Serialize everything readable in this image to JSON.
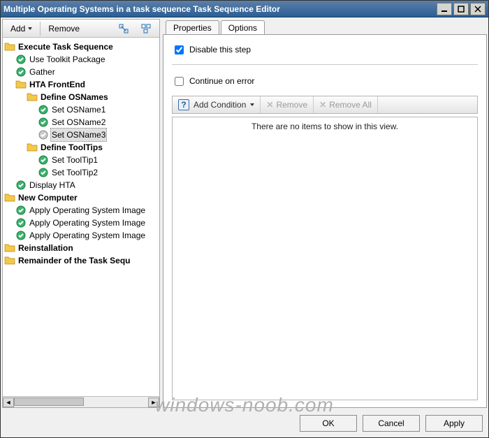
{
  "title": "Multiple Operating Systems in a task sequence Task Sequence Editor",
  "left_toolbar": {
    "add": "Add",
    "remove": "Remove"
  },
  "tree": [
    {
      "depth": 0,
      "icon": "folder",
      "label": "Execute Task Sequence",
      "bold": true
    },
    {
      "depth": 1,
      "icon": "check",
      "label": "Use Toolkit Package"
    },
    {
      "depth": 1,
      "icon": "check",
      "label": "Gather"
    },
    {
      "depth": 1,
      "icon": "folder",
      "label": "HTA FrontEnd",
      "bold": true
    },
    {
      "depth": 2,
      "icon": "folder",
      "label": "Define OSNames",
      "bold": true
    },
    {
      "depth": 3,
      "icon": "check",
      "label": "Set OSName1"
    },
    {
      "depth": 3,
      "icon": "check",
      "label": "Set OSName2"
    },
    {
      "depth": 3,
      "icon": "gray",
      "label": "Set OSName3",
      "selected": true
    },
    {
      "depth": 2,
      "icon": "folder",
      "label": "Define ToolTips",
      "bold": true
    },
    {
      "depth": 3,
      "icon": "check",
      "label": "Set ToolTip1"
    },
    {
      "depth": 3,
      "icon": "check",
      "label": "Set ToolTip2"
    },
    {
      "depth": 1,
      "icon": "check",
      "label": "Display HTA"
    },
    {
      "depth": 0,
      "icon": "folder",
      "label": "New Computer",
      "bold": true
    },
    {
      "depth": 1,
      "icon": "check",
      "label": "Apply Operating System Image"
    },
    {
      "depth": 1,
      "icon": "check",
      "label": "Apply Operating System Image"
    },
    {
      "depth": 1,
      "icon": "check",
      "label": "Apply Operating System Image"
    },
    {
      "depth": 0,
      "icon": "folder",
      "label": "Reinstallation",
      "bold": true
    },
    {
      "depth": 0,
      "icon": "folder",
      "label": "Remainder of the Task Sequ",
      "bold": true
    }
  ],
  "tabs": {
    "properties": "Properties",
    "options": "Options",
    "active": 1
  },
  "options": {
    "disable_label": "Disable this step",
    "disable_checked": true,
    "continue_label": "Continue on error",
    "continue_checked": false,
    "add_condition": "Add Condition",
    "remove": "Remove",
    "remove_all": "Remove All",
    "empty": "There are no items to show in this view."
  },
  "footer": {
    "ok": "OK",
    "cancel": "Cancel",
    "apply": "Apply"
  },
  "watermark": "windows-noob.com"
}
